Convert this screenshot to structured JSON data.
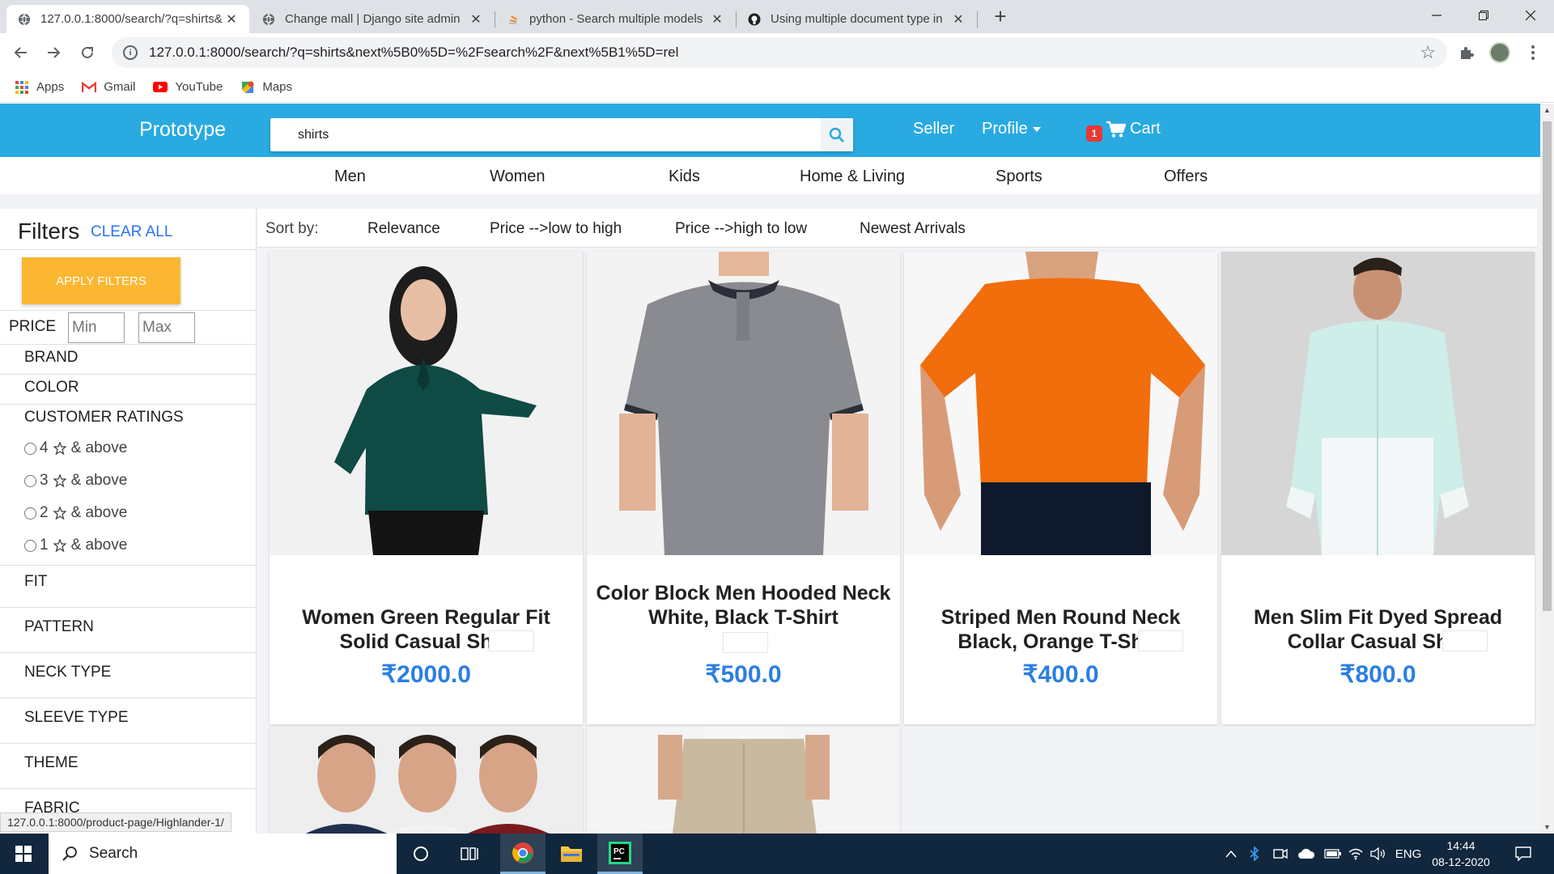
{
  "browser": {
    "tabs": [
      {
        "title": "127.0.0.1:8000/search/?q=shirts&",
        "favicon": "globe-icon",
        "active": true
      },
      {
        "title": "Change mall | Django site admin",
        "favicon": "globe-icon",
        "active": false
      },
      {
        "title": "python - Search multiple models",
        "favicon": "stackoverflow-icon",
        "active": false
      },
      {
        "title": "Using multiple document type in",
        "favicon": "github-icon",
        "active": false
      }
    ],
    "new_tab_label": "+",
    "url": "127.0.0.1:8000/search/?q=shirts&next%5B0%5D=%2Fsearch%2F&next%5B1%5D=rel",
    "bookmarks": [
      {
        "label": "Apps",
        "icon": "apps-grid-icon"
      },
      {
        "label": "Gmail",
        "icon": "gmail-icon"
      },
      {
        "label": "YouTube",
        "icon": "youtube-icon"
      },
      {
        "label": "Maps",
        "icon": "maps-icon"
      }
    ],
    "status_url": "127.0.0.1:8000/product-page/Highlander-1/"
  },
  "site": {
    "brand": "Prototype",
    "search": {
      "value": "shirts",
      "placeholder": ""
    },
    "seller_label": "Seller",
    "profile_label": "Profile",
    "cart_label": "Cart",
    "cart_count": "1",
    "accent_color": "#29aae1",
    "categories": [
      "Men",
      "Women",
      "Kids",
      "Home & Living",
      "Sports",
      "Offers"
    ]
  },
  "filters": {
    "title": "Filters",
    "clear_all": "CLEAR ALL",
    "apply": "APPLY FILTERS",
    "price_label": "PRICE",
    "min_placeholder": "Min",
    "max_placeholder": "Max",
    "brand": "BRAND",
    "color": "COLOR",
    "customer_ratings": "CUSTOMER RATINGS",
    "ratings": [
      {
        "value": "4",
        "suffix": "& above"
      },
      {
        "value": "3",
        "suffix": "& above"
      },
      {
        "value": "2",
        "suffix": "& above"
      },
      {
        "value": "1",
        "suffix": "& above"
      }
    ],
    "sections": [
      "FIT",
      "PATTERN",
      "NECK TYPE",
      "SLEEVE TYPE",
      "THEME",
      "FABRIC"
    ]
  },
  "sort": {
    "label": "Sort by:",
    "options": [
      "Relevance",
      "Price -->low to high",
      "Price -->high to low",
      "Newest Arrivals"
    ]
  },
  "products": [
    {
      "name": "Women Green Regular Fit Solid Casual Shirt",
      "price": "₹2000.0",
      "image": "woman-green-shirt"
    },
    {
      "name": "Color Block Men Hooded Neck White, Black T-Shirt",
      "price": "₹500.0",
      "image": "man-grey-polo"
    },
    {
      "name": "Striped Men Round Neck Black, Orange T-Shirt",
      "price": "₹400.0",
      "image": "man-orange-tshirt"
    },
    {
      "name": "Men Slim Fit Dyed Spread Collar Casual Shirt",
      "price": "₹800.0",
      "image": "man-white-shirt"
    }
  ],
  "taskbar": {
    "search_label": "Search",
    "language": "ENG",
    "time": "14:44",
    "date": "08-12-2020"
  }
}
